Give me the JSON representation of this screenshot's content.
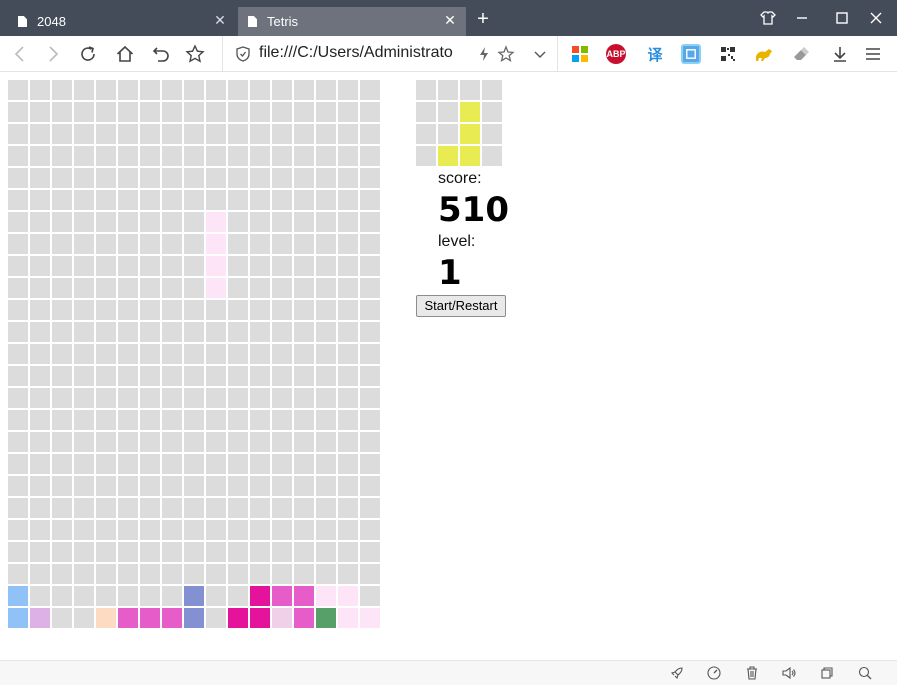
{
  "tabs": [
    {
      "title": "2048",
      "active": false
    },
    {
      "title": "Tetris",
      "active": true
    }
  ],
  "address": {
    "url": "file:///C:/Users/Administrato"
  },
  "extensions": {
    "abp_label": "ABP",
    "translate_label": "译"
  },
  "game": {
    "cols": 17,
    "rows": 25,
    "empty_color": "#dcdcdc",
    "cells": [
      {
        "r": 6,
        "c": 9,
        "color": "#fde4f6"
      },
      {
        "r": 7,
        "c": 9,
        "color": "#fde4f6"
      },
      {
        "r": 8,
        "c": 9,
        "color": "#fde4f6"
      },
      {
        "r": 9,
        "c": 9,
        "color": "#fde4f6"
      },
      {
        "r": 23,
        "c": 0,
        "color": "#90c2f8"
      },
      {
        "r": 23,
        "c": 8,
        "color": "#8391d3"
      },
      {
        "r": 23,
        "c": 11,
        "color": "#e5139c"
      },
      {
        "r": 23,
        "c": 12,
        "color": "#e65cc9"
      },
      {
        "r": 23,
        "c": 13,
        "color": "#e65cc9"
      },
      {
        "r": 23,
        "c": 14,
        "color": "#fde4f6"
      },
      {
        "r": 23,
        "c": 15,
        "color": "#fde4f6"
      },
      {
        "r": 24,
        "c": 0,
        "color": "#90c2f8"
      },
      {
        "r": 24,
        "c": 1,
        "color": "#ddb0e6"
      },
      {
        "r": 24,
        "c": 4,
        "color": "#fddbc2"
      },
      {
        "r": 24,
        "c": 5,
        "color": "#e65cc9"
      },
      {
        "r": 24,
        "c": 6,
        "color": "#e65cc9"
      },
      {
        "r": 24,
        "c": 7,
        "color": "#e65cc9"
      },
      {
        "r": 24,
        "c": 8,
        "color": "#8391d3"
      },
      {
        "r": 24,
        "c": 10,
        "color": "#e5139c"
      },
      {
        "r": 24,
        "c": 11,
        "color": "#e5139c"
      },
      {
        "r": 24,
        "c": 12,
        "color": "#f0d0e8"
      },
      {
        "r": 24,
        "c": 13,
        "color": "#e65cc9"
      },
      {
        "r": 24,
        "c": 14,
        "color": "#58a06a"
      },
      {
        "r": 24,
        "c": 15,
        "color": "#fde4f6"
      },
      {
        "r": 24,
        "c": 16,
        "color": "#fde4f6"
      }
    ],
    "next_piece": {
      "cols": 4,
      "rows": 4,
      "color": "#e8ec52",
      "cells": [
        [
          1,
          2
        ],
        [
          2,
          2
        ],
        [
          3,
          2
        ],
        [
          3,
          1
        ]
      ]
    },
    "score_label": "score:",
    "score": "510",
    "level_label": "level:",
    "level": "1",
    "start_label": "Start/Restart"
  }
}
